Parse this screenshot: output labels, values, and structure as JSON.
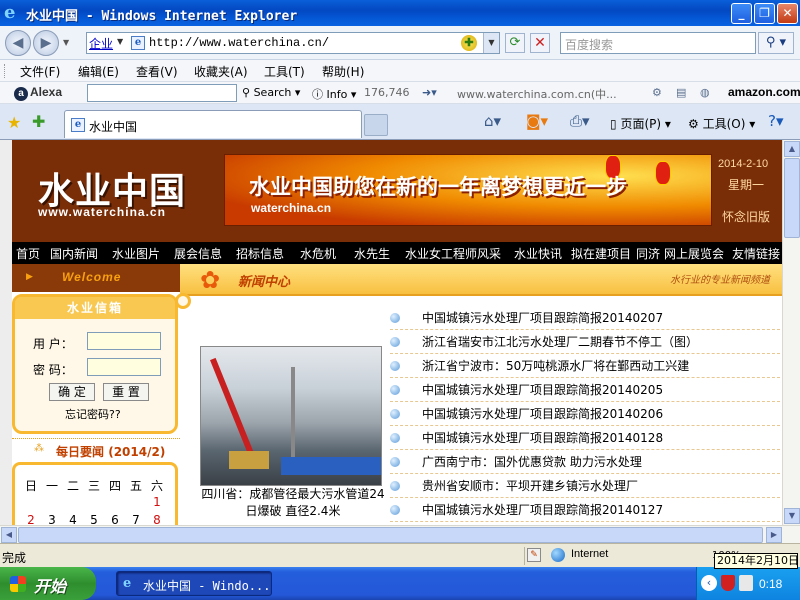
{
  "window": {
    "title": "水业中国 - Windows Internet Explorer",
    "minimize_glyph": "_",
    "maximize_glyph": "❐",
    "close_glyph": "✕"
  },
  "address_bar": {
    "channel_label": "企业",
    "url": "http://www.waterchina.cn/",
    "search_placeholder": "百度搜索"
  },
  "menu": {
    "items": [
      "文件(F)",
      "编辑(E)",
      "查看(V)",
      "收藏夹(A)",
      "工具(T)",
      "帮助(H)"
    ]
  },
  "alexa": {
    "logo": "Alexa",
    "search_label": "Search",
    "info_label": "Info",
    "rank": "176,746",
    "site_label": "www.waterchina.com.cn(中...",
    "amazon_label": "amazon.com"
  },
  "tabs": {
    "active_title": "水业中国",
    "page_label": "页面(P)",
    "tools_label": "工具(O)"
  },
  "site": {
    "logo_cn": "水业中国",
    "logo_url": "www.waterchina.cn",
    "banner_slogan": "水业中国助您在新的一年离梦想更近一步",
    "banner_url": "waterchina.cn",
    "date": "2014-2-10",
    "weekday": "星期一",
    "old_version": "怀念旧版",
    "nav": [
      "首页",
      "国内新闻",
      "水业图片",
      "展会信息",
      "招标信息",
      "水危机",
      "水先生",
      "水业女工程师风采",
      "水业快讯",
      "拟在建项目",
      "同济",
      "网上展览会",
      "友情链接"
    ],
    "welcome": "Welcome",
    "news_center": "新闻中心",
    "tagline": "水行业的专业新闻频道",
    "mailbox": {
      "title": "水业信箱",
      "user_label": "用 户：",
      "pass_label": "密 码：",
      "ok_button": "确 定",
      "reset_button": "重 置",
      "forgot": "忘记密码??"
    },
    "daily": {
      "title": "每日要闻",
      "month": "(2014/2)"
    },
    "calendar": {
      "weekdays": [
        "日",
        "一",
        "二",
        "三",
        "四",
        "五",
        "六"
      ],
      "row1": [
        "",
        "",
        "",
        "",
        "",
        "",
        "1"
      ],
      "row2": [
        "2",
        "3",
        "4",
        "5",
        "6",
        "7",
        "8"
      ]
    },
    "photo_caption": "四川省：成都管径最大污水管道24日爆破 直径2.4米",
    "news": [
      "中国城镇污水处理厂项目跟踪简报20140207",
      "浙江省瑞安市江北污水处理厂二期春节不停工（图）",
      "浙江省宁波市：50万吨桃源水厂将在鄞西动工兴建",
      "中国城镇污水处理厂项目跟踪简报20140205",
      "中国城镇污水处理厂项目跟踪简报20140206",
      "中国城镇污水处理厂项目跟踪简报20140128",
      "广西南宁市：国外优惠贷款 助力污水处理",
      "贵州省安顺市：平坝开建乡镇污水处理厂",
      "中国城镇污水处理厂项目跟踪简报20140127"
    ]
  },
  "status": {
    "text": "完成",
    "zone": "Internet",
    "zoom": "100%",
    "tooltip": "2014年2月10日"
  },
  "taskbar": {
    "start_label": "开始",
    "task_label": "水业中国 - Windo...",
    "clock": "0:18"
  },
  "colors": {
    "header_brown": "#7A2E08",
    "accent_orange": "#F8B830",
    "news_title": "#C04000"
  }
}
